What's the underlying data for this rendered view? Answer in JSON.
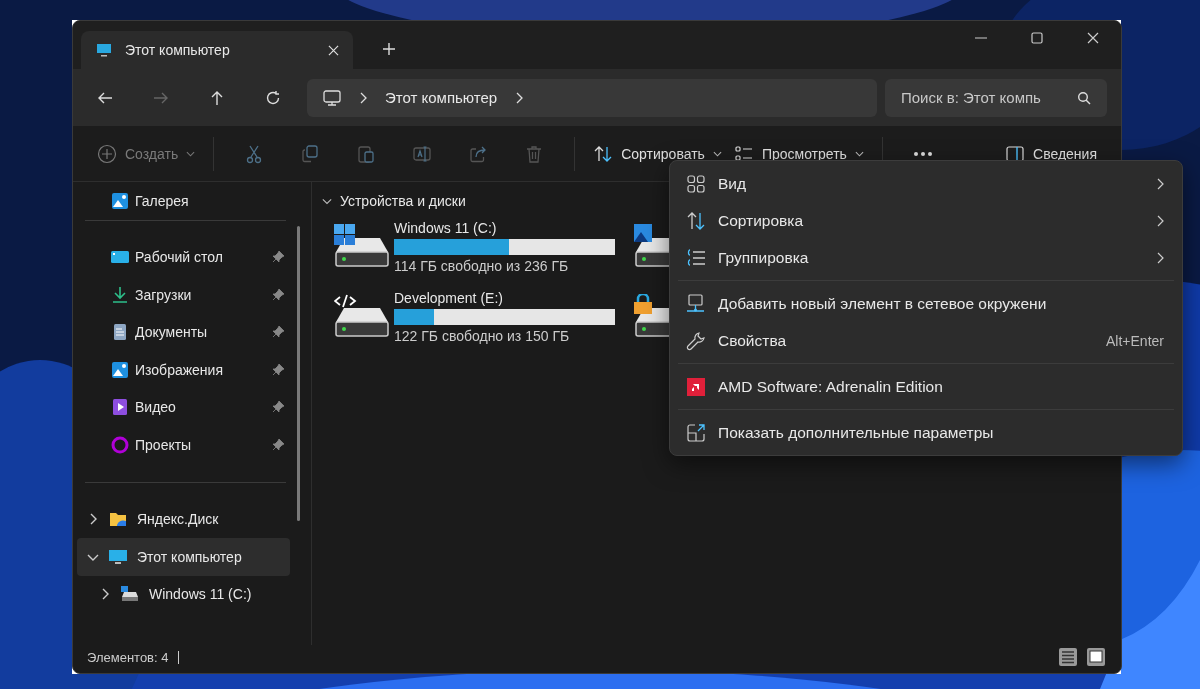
{
  "tab": {
    "title": "Этот компьютер"
  },
  "address": {
    "path": [
      "Этот компьютер"
    ]
  },
  "search": {
    "placeholder": "Поиск в: Этот компь"
  },
  "toolbar": {
    "create": "Создать",
    "sort": "Сортировать",
    "view": "Просмотреть",
    "details": "Сведения"
  },
  "sidebar": {
    "quick": [
      {
        "label": "Галерея",
        "pinned": false
      },
      {
        "label": "Рабочий стол",
        "pinned": true
      },
      {
        "label": "Загрузки",
        "pinned": true
      },
      {
        "label": "Документы",
        "pinned": true
      },
      {
        "label": "Изображения",
        "pinned": true
      },
      {
        "label": "Видео",
        "pinned": true
      },
      {
        "label": "Проекты",
        "pinned": true
      }
    ],
    "tree": [
      {
        "label": "Яндекс.Диск",
        "expanded": false,
        "selected": false
      },
      {
        "label": "Этот компьютер",
        "expanded": true,
        "selected": true,
        "children": [
          {
            "label": "Windows 11 (C:)",
            "expanded": false,
            "selected": false
          }
        ]
      }
    ]
  },
  "section": {
    "title": "Устройства и диски",
    "expanded": true
  },
  "drives": [
    {
      "kind": "tile",
      "name": "Windows 11 (C:)",
      "level": 0.52,
      "usage": "114 ГБ свободно из 236 ГБ"
    },
    {
      "kind": "covered"
    },
    {
      "kind": "tile",
      "name": "Development (E:)",
      "level": 0.18,
      "usage": "122 ГБ свободно из 150 ГБ"
    },
    {
      "kind": "covered"
    }
  ],
  "context_menu": {
    "groups": [
      [
        {
          "label": "Вид",
          "submenu": true
        },
        {
          "label": "Сортировка",
          "submenu": true
        },
        {
          "label": "Группировка",
          "submenu": true
        }
      ],
      [
        {
          "label": "Добавить новый элемент в сетевое окружени",
          "submenu": false
        },
        {
          "label": "Свойства",
          "submenu": false,
          "shortcut": "Alt+Enter"
        }
      ],
      [
        {
          "label": "AMD Software: Adrenalin Edition",
          "submenu": false
        }
      ],
      [
        {
          "label": "Показать дополнительные параметры",
          "submenu": false
        }
      ]
    ]
  },
  "status_bar": {
    "count": "Элементов: 4",
    "views": [
      {
        "kind": "details",
        "selected": false
      },
      {
        "kind": "tiles",
        "selected": true
      }
    ]
  }
}
